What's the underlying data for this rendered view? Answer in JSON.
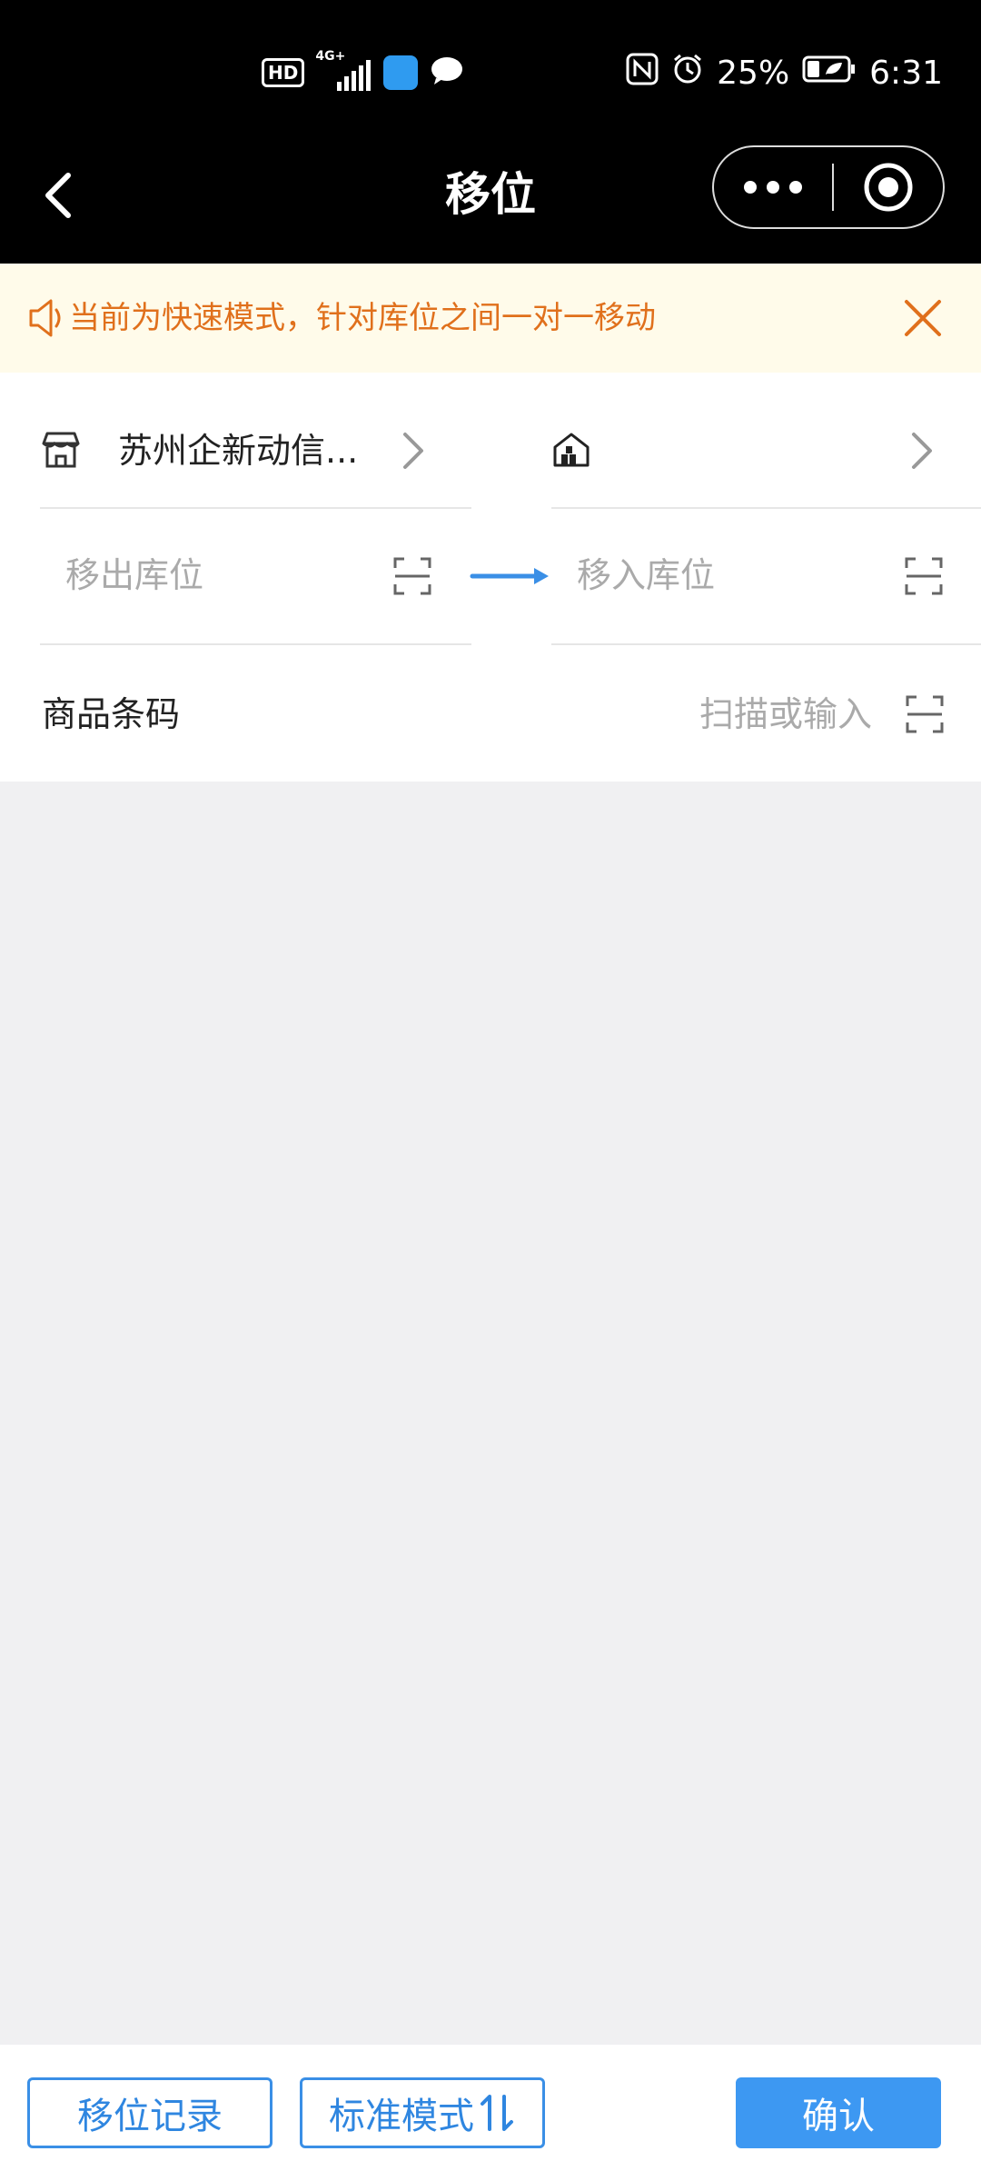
{
  "status_bar": {
    "hd_badge": "HD",
    "network": "4G+",
    "battery": "25%",
    "time": "6:31",
    "icons": [
      "hd-icon",
      "signal-icon",
      "app-notification-icon",
      "chat-bubble-icon",
      "nfc-icon",
      "alarm-icon",
      "battery-icon"
    ]
  },
  "nav": {
    "title": "移位",
    "icons": [
      "back-arrow-icon",
      "more-dots-icon",
      "target-circle-icon"
    ]
  },
  "notice": {
    "text": "当前为快速模式，针对库位之间一对一移动",
    "color": "#e0701c",
    "background": "#fffbea",
    "icons": [
      "speaker-icon",
      "close-icon"
    ]
  },
  "form": {
    "source_store": "苏州企新动信...",
    "target_store": "",
    "source_location_placeholder": "移出库位",
    "target_location_placeholder": "移入库位",
    "barcode_label": "商品条码",
    "barcode_placeholder": "扫描或输入",
    "icons": [
      "store-icon",
      "warehouse-icon",
      "chevron-right-icon",
      "scan-icon",
      "arrow-right-icon"
    ]
  },
  "bottom": {
    "record_button": "移位记录",
    "mode_button": "标准模式",
    "confirm_button": "确认",
    "accent_color": "#3a8fe6",
    "icons": [
      "swap-vertical-icon"
    ]
  }
}
